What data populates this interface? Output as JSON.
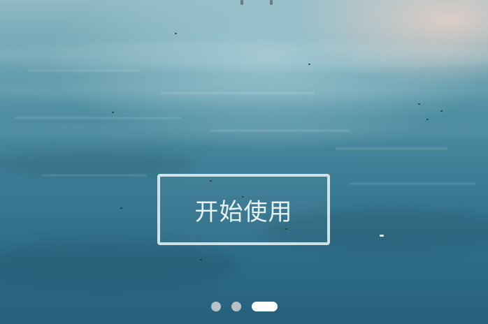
{
  "screen": {
    "background": "beach-water-photo"
  },
  "start_button": {
    "label": "开始使用"
  },
  "pager": {
    "pages": 3,
    "active_index": 2
  },
  "colors": {
    "button_border": "#dcecf0",
    "button_text": "#e6f1f4",
    "dot_inactive": "#d2d2d2",
    "dot_active": "#ffffff",
    "water_dark": "#25607c",
    "water_light": "#8fb9c4"
  }
}
